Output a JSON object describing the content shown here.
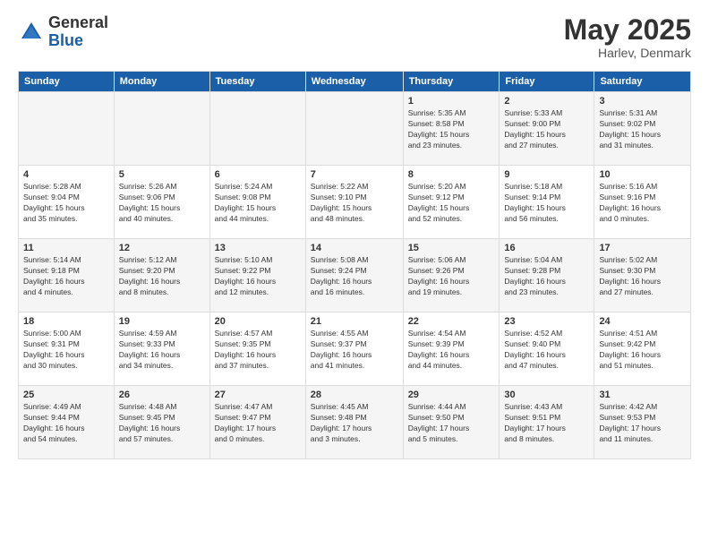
{
  "header": {
    "logo_general": "General",
    "logo_blue": "Blue",
    "month": "May 2025",
    "location": "Harlev, Denmark"
  },
  "weekdays": [
    "Sunday",
    "Monday",
    "Tuesday",
    "Wednesday",
    "Thursday",
    "Friday",
    "Saturday"
  ],
  "weeks": [
    [
      {
        "day": "",
        "info": ""
      },
      {
        "day": "",
        "info": ""
      },
      {
        "day": "",
        "info": ""
      },
      {
        "day": "",
        "info": ""
      },
      {
        "day": "1",
        "info": "Sunrise: 5:35 AM\nSunset: 8:58 PM\nDaylight: 15 hours\nand 23 minutes."
      },
      {
        "day": "2",
        "info": "Sunrise: 5:33 AM\nSunset: 9:00 PM\nDaylight: 15 hours\nand 27 minutes."
      },
      {
        "day": "3",
        "info": "Sunrise: 5:31 AM\nSunset: 9:02 PM\nDaylight: 15 hours\nand 31 minutes."
      }
    ],
    [
      {
        "day": "4",
        "info": "Sunrise: 5:28 AM\nSunset: 9:04 PM\nDaylight: 15 hours\nand 35 minutes."
      },
      {
        "day": "5",
        "info": "Sunrise: 5:26 AM\nSunset: 9:06 PM\nDaylight: 15 hours\nand 40 minutes."
      },
      {
        "day": "6",
        "info": "Sunrise: 5:24 AM\nSunset: 9:08 PM\nDaylight: 15 hours\nand 44 minutes."
      },
      {
        "day": "7",
        "info": "Sunrise: 5:22 AM\nSunset: 9:10 PM\nDaylight: 15 hours\nand 48 minutes."
      },
      {
        "day": "8",
        "info": "Sunrise: 5:20 AM\nSunset: 9:12 PM\nDaylight: 15 hours\nand 52 minutes."
      },
      {
        "day": "9",
        "info": "Sunrise: 5:18 AM\nSunset: 9:14 PM\nDaylight: 15 hours\nand 56 minutes."
      },
      {
        "day": "10",
        "info": "Sunrise: 5:16 AM\nSunset: 9:16 PM\nDaylight: 16 hours\nand 0 minutes."
      }
    ],
    [
      {
        "day": "11",
        "info": "Sunrise: 5:14 AM\nSunset: 9:18 PM\nDaylight: 16 hours\nand 4 minutes."
      },
      {
        "day": "12",
        "info": "Sunrise: 5:12 AM\nSunset: 9:20 PM\nDaylight: 16 hours\nand 8 minutes."
      },
      {
        "day": "13",
        "info": "Sunrise: 5:10 AM\nSunset: 9:22 PM\nDaylight: 16 hours\nand 12 minutes."
      },
      {
        "day": "14",
        "info": "Sunrise: 5:08 AM\nSunset: 9:24 PM\nDaylight: 16 hours\nand 16 minutes."
      },
      {
        "day": "15",
        "info": "Sunrise: 5:06 AM\nSunset: 9:26 PM\nDaylight: 16 hours\nand 19 minutes."
      },
      {
        "day": "16",
        "info": "Sunrise: 5:04 AM\nSunset: 9:28 PM\nDaylight: 16 hours\nand 23 minutes."
      },
      {
        "day": "17",
        "info": "Sunrise: 5:02 AM\nSunset: 9:30 PM\nDaylight: 16 hours\nand 27 minutes."
      }
    ],
    [
      {
        "day": "18",
        "info": "Sunrise: 5:00 AM\nSunset: 9:31 PM\nDaylight: 16 hours\nand 30 minutes."
      },
      {
        "day": "19",
        "info": "Sunrise: 4:59 AM\nSunset: 9:33 PM\nDaylight: 16 hours\nand 34 minutes."
      },
      {
        "day": "20",
        "info": "Sunrise: 4:57 AM\nSunset: 9:35 PM\nDaylight: 16 hours\nand 37 minutes."
      },
      {
        "day": "21",
        "info": "Sunrise: 4:55 AM\nSunset: 9:37 PM\nDaylight: 16 hours\nand 41 minutes."
      },
      {
        "day": "22",
        "info": "Sunrise: 4:54 AM\nSunset: 9:39 PM\nDaylight: 16 hours\nand 44 minutes."
      },
      {
        "day": "23",
        "info": "Sunrise: 4:52 AM\nSunset: 9:40 PM\nDaylight: 16 hours\nand 47 minutes."
      },
      {
        "day": "24",
        "info": "Sunrise: 4:51 AM\nSunset: 9:42 PM\nDaylight: 16 hours\nand 51 minutes."
      }
    ],
    [
      {
        "day": "25",
        "info": "Sunrise: 4:49 AM\nSunset: 9:44 PM\nDaylight: 16 hours\nand 54 minutes."
      },
      {
        "day": "26",
        "info": "Sunrise: 4:48 AM\nSunset: 9:45 PM\nDaylight: 16 hours\nand 57 minutes."
      },
      {
        "day": "27",
        "info": "Sunrise: 4:47 AM\nSunset: 9:47 PM\nDaylight: 17 hours\nand 0 minutes."
      },
      {
        "day": "28",
        "info": "Sunrise: 4:45 AM\nSunset: 9:48 PM\nDaylight: 17 hours\nand 3 minutes."
      },
      {
        "day": "29",
        "info": "Sunrise: 4:44 AM\nSunset: 9:50 PM\nDaylight: 17 hours\nand 5 minutes."
      },
      {
        "day": "30",
        "info": "Sunrise: 4:43 AM\nSunset: 9:51 PM\nDaylight: 17 hours\nand 8 minutes."
      },
      {
        "day": "31",
        "info": "Sunrise: 4:42 AM\nSunset: 9:53 PM\nDaylight: 17 hours\nand 11 minutes."
      }
    ]
  ]
}
